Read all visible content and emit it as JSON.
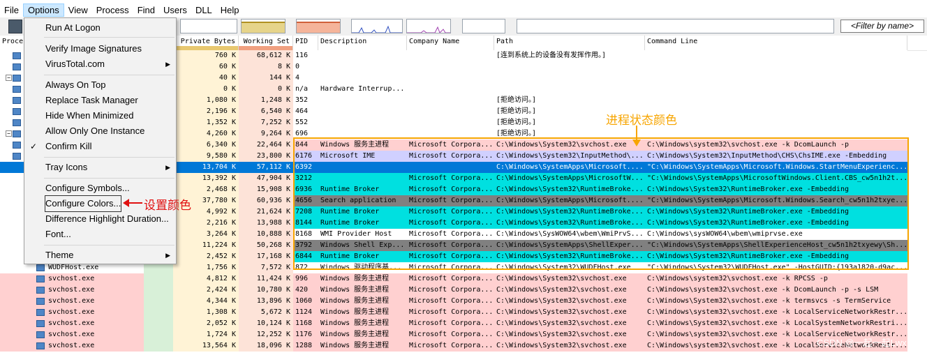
{
  "menubar": [
    "File",
    "Options",
    "View",
    "Process",
    "Find",
    "Users",
    "DLL",
    "Help"
  ],
  "filter_placeholder": "<Filter by name>",
  "columns": [
    "Process",
    "Private Bytes",
    "Working Set",
    "PID",
    "Description",
    "Company Name",
    "Path",
    "Command Line"
  ],
  "colors": {
    "service": "#ffd0d0",
    "immersive": "#00e0e0",
    "suspended": "#808080",
    "packed": "#d0d0ff",
    "selected": "#0078d7",
    "annotation": "#f7a500",
    "annotation_red": "#e01010"
  },
  "options_menu": {
    "items": [
      {
        "label": "Run At Logon"
      },
      {
        "label": "Verify Image Signatures"
      },
      {
        "label": "VirusTotal.com",
        "submenu": true
      },
      {
        "label": "Always On Top"
      },
      {
        "label": "Replace Task Manager"
      },
      {
        "label": "Hide When Minimized"
      },
      {
        "label": "Allow Only One Instance"
      },
      {
        "label": "Confirm Kill",
        "checked": true
      },
      {
        "label": "Tray Icons",
        "submenu": true
      },
      {
        "label": "Configure Symbols..."
      },
      {
        "label": "Configure Colors..."
      },
      {
        "label": "Difference Highlight Duration..."
      },
      {
        "label": "Font..."
      },
      {
        "label": "Theme",
        "submenu": true
      }
    ],
    "check_glyph": "✓",
    "arrow_glyph": "▶"
  },
  "annotations": {
    "colors_label": "进程状态颜色",
    "set_colors_label": "设置颜色",
    "watermark": "CSDN @一起一起Lwx"
  },
  "rows": [
    {
      "name": "",
      "priv": "760 K",
      "ws": "68,612 K",
      "pid": "116",
      "desc": "",
      "company": "",
      "path": "[连到系统上的设备没有发挥作用。]",
      "cmd": "",
      "type": "normal"
    },
    {
      "name": "",
      "priv": "60 K",
      "ws": "8 K",
      "pid": "0",
      "desc": "",
      "company": "",
      "path": "",
      "cmd": "",
      "type": "normal"
    },
    {
      "name": "",
      "priv": "40 K",
      "ws": "144 K",
      "pid": "4",
      "desc": "",
      "company": "",
      "path": "",
      "cmd": "",
      "type": "normal"
    },
    {
      "name": "",
      "priv": "0 K",
      "ws": "0 K",
      "pid": "n/a",
      "desc": "Hardware Interrup...",
      "company": "",
      "path": "",
      "cmd": "",
      "type": "normal"
    },
    {
      "name": "",
      "priv": "1,080 K",
      "ws": "1,248 K",
      "pid": "352",
      "desc": "",
      "company": "",
      "path": "[拒绝访问。]",
      "cmd": "",
      "type": "normal"
    },
    {
      "name": "",
      "priv": "2,196 K",
      "ws": "6,540 K",
      "pid": "464",
      "desc": "",
      "company": "",
      "path": "[拒绝访问。]",
      "cmd": "",
      "type": "normal"
    },
    {
      "name": "",
      "priv": "1,352 K",
      "ws": "7,252 K",
      "pid": "552",
      "desc": "",
      "company": "",
      "path": "[拒绝访问。]",
      "cmd": "",
      "type": "normal"
    },
    {
      "name": "",
      "priv": "4,260 K",
      "ws": "9,264 K",
      "pid": "696",
      "desc": "",
      "company": "",
      "path": "[拒绝访问。]",
      "cmd": "",
      "type": "normal"
    },
    {
      "name": "",
      "priv": "6,340 K",
      "ws": "22,464 K",
      "pid": "844",
      "desc": "Windows 服务主进程",
      "company": "Microsoft Corpora...",
      "path": "C:\\Windows\\System32\\svchost.exe",
      "cmd": "C:\\Windows\\system32\\svchost.exe -k DcomLaunch -p",
      "type": "service"
    },
    {
      "name": "",
      "priv": "9,580 K",
      "ws": "23,800 K",
      "pid": "6176",
      "desc": "Microsoft IME",
      "company": "Microsoft Corpora...",
      "path": "C:\\Windows\\System32\\InputMethod\\...",
      "cmd": "C:\\Windows\\System32\\InputMethod\\CHS\\ChsIME.exe -Embedding",
      "type": "packed"
    },
    {
      "name": "",
      "priv": "13,704 K",
      "ws": "57,112 K",
      "pid": "6392",
      "desc": "",
      "company": "",
      "path": "C:\\Windows\\SystemApps\\Microsoft....",
      "cmd": "\"C:\\Windows\\SystemApps\\Microsoft.Windows.StartMenuExperienc...",
      "type": "selected"
    },
    {
      "name": "",
      "priv": "13,392 K",
      "ws": "47,904 K",
      "pid": "3212",
      "desc": "",
      "company": "Microsoft Corpora...",
      "path": "C:\\Windows\\SystemApps\\MicrosoftW...",
      "cmd": "\"C:\\Windows\\SystemApps\\MicrosoftWindows.Client.CBS_cw5n1h2t...",
      "type": "immersive"
    },
    {
      "name": "",
      "priv": "2,468 K",
      "ws": "15,908 K",
      "pid": "6936",
      "desc": "Runtime Broker",
      "company": "Microsoft Corpora...",
      "path": "C:\\Windows\\System32\\RuntimeBroke...",
      "cmd": "C:\\Windows\\System32\\RuntimeBroker.exe -Embedding",
      "type": "immersive"
    },
    {
      "name": "",
      "priv": "37,780 K",
      "ws": "60,936 K",
      "pid": "4656",
      "desc": "Search application",
      "company": "Microsoft Corpora...",
      "path": "C:\\Windows\\SystemApps\\Microsoft....",
      "cmd": "\"C:\\Windows\\SystemApps\\Microsoft.Windows.Search_cw5n1h2txye...",
      "type": "suspended"
    },
    {
      "name": "",
      "priv": "4,992 K",
      "ws": "21,624 K",
      "pid": "7208",
      "desc": "Runtime Broker",
      "company": "Microsoft Corpora...",
      "path": "C:\\Windows\\System32\\RuntimeBroke...",
      "cmd": "C:\\Windows\\System32\\RuntimeBroker.exe -Embedding",
      "type": "immersive"
    },
    {
      "name": "",
      "priv": "2,216 K",
      "ws": "13,988 K",
      "pid": "8144",
      "desc": "Runtime Broker",
      "company": "Microsoft Corpora...",
      "path": "C:\\Windows\\System32\\RuntimeBroke...",
      "cmd": "C:\\Windows\\System32\\RuntimeBroker.exe -Embedding",
      "type": "immersive"
    },
    {
      "name": "",
      "priv": "3,264 K",
      "ws": "10,888 K",
      "pid": "8168",
      "desc": "WMI Provider Host",
      "company": "Microsoft Corpora...",
      "path": "C:\\Windows\\SysWOW64\\wbem\\WmiPrvS...",
      "cmd": "C:\\Windows\\sysWOW64\\wbem\\wmiprvse.exe",
      "type": "normal"
    },
    {
      "name": "",
      "priv": "11,224 K",
      "ws": "50,268 K",
      "pid": "3792",
      "desc": "Windows Shell Exp...",
      "company": "Microsoft Corpora...",
      "path": "C:\\Windows\\SystemApps\\ShellExper...",
      "cmd": "\"C:\\Windows\\SystemApps\\ShellExperienceHost_cw5n1h2txyewy\\Sh...",
      "type": "suspended"
    },
    {
      "name": "",
      "priv": "2,452 K",
      "ws": "17,168 K",
      "pid": "6844",
      "desc": "Runtime Broker",
      "company": "Microsoft Corpora...",
      "path": "C:\\Windows\\System32\\RuntimeBroke...",
      "cmd": "C:\\Windows\\System32\\RuntimeBroker.exe -Embedding",
      "type": "immersive"
    },
    {
      "name": "WUDFHost.exe",
      "priv": "1,756 K",
      "ws": "7,572 K",
      "pid": "872",
      "desc": "Windows 驱动程序基...",
      "company": "Microsoft Corpora...",
      "path": "C:\\Windows\\System32\\WUDFHost.exe",
      "cmd": "\"C:\\Windows\\System32\\WUDFHost.exe\" -HostGUID:{193a1820-d9ac...",
      "type": "normal"
    },
    {
      "name": "svchost.exe",
      "priv": "4,812 K",
      "ws": "11,424 K",
      "pid": "996",
      "desc": "Windows 服务主进程",
      "company": "Microsoft Corpora...",
      "path": "C:\\Windows\\System32\\svchost.exe",
      "cmd": "C:\\Windows\\system32\\svchost.exe -k RPCSS -p",
      "type": "service"
    },
    {
      "name": "svchost.exe",
      "priv": "2,424 K",
      "ws": "10,780 K",
      "pid": "420",
      "desc": "Windows 服务主进程",
      "company": "Microsoft Corpora...",
      "path": "C:\\Windows\\System32\\svchost.exe",
      "cmd": "C:\\Windows\\system32\\svchost.exe -k DcomLaunch -p -s LSM",
      "type": "service"
    },
    {
      "name": "svchost.exe",
      "priv": "4,344 K",
      "ws": "13,896 K",
      "pid": "1060",
      "desc": "Windows 服务主进程",
      "company": "Microsoft Corpora...",
      "path": "C:\\Windows\\System32\\svchost.exe",
      "cmd": "C:\\Windows\\System32\\svchost.exe -k termsvcs -s TermService",
      "type": "service"
    },
    {
      "name": "svchost.exe",
      "priv": "1,308 K",
      "ws": "5,672 K",
      "pid": "1124",
      "desc": "Windows 服务主进程",
      "company": "Microsoft Corpora...",
      "path": "C:\\Windows\\System32\\svchost.exe",
      "cmd": "C:\\Windows\\system32\\svchost.exe -k LocalServiceNetworkRestr...",
      "type": "service"
    },
    {
      "name": "svchost.exe",
      "priv": "2,052 K",
      "ws": "10,124 K",
      "pid": "1168",
      "desc": "Windows 服务主进程",
      "company": "Microsoft Corpora...",
      "path": "C:\\Windows\\System32\\svchost.exe",
      "cmd": "C:\\Windows\\System32\\svchost.exe -k LocalSystemNetworkRestri...",
      "type": "service"
    },
    {
      "name": "svchost.exe",
      "priv": "1,724 K",
      "ws": "12,252 K",
      "pid": "1176",
      "desc": "Windows 服务主进程",
      "company": "Microsoft Corpora...",
      "path": "C:\\Windows\\System32\\svchost.exe",
      "cmd": "C:\\Windows\\system32\\svchost.exe -k LocalServiceNetworkRestr...",
      "type": "service"
    },
    {
      "name": "svchost.exe",
      "priv": "13,564 K",
      "ws": "18,096 K",
      "pid": "1288",
      "desc": "Windows 服务主进程",
      "company": "Microsoft Corpora...",
      "path": "C:\\Windows\\System32\\svchost.exe",
      "cmd": "C:\\Windows\\system32\\svchost.exe -k LocalServiceNetworkRestr...",
      "type": "service"
    }
  ]
}
